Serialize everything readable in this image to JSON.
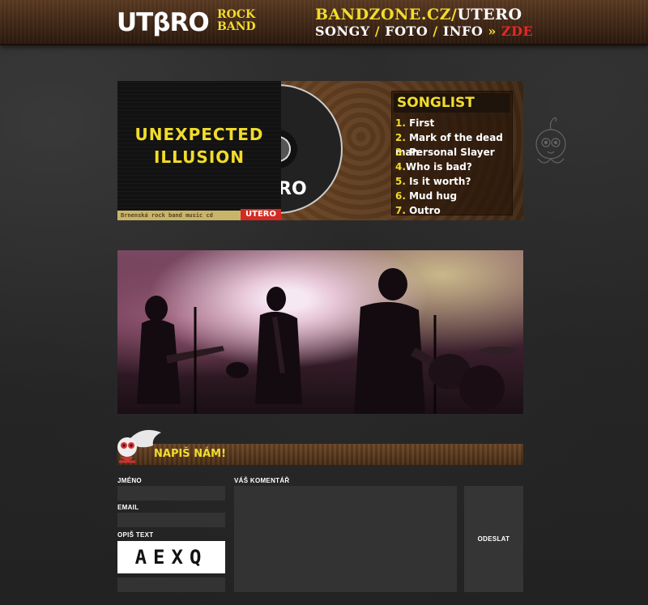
{
  "header": {
    "logo_text": "UTβRO",
    "logo_sub_1": "ROCK",
    "logo_sub_2": "BAND",
    "link_prefix": "BANDZONE.CZ/",
    "link_suffix": "UTERO",
    "nav": [
      {
        "label": "SONGY"
      },
      {
        "label": "FOTO"
      },
      {
        "label": "INFO"
      },
      {
        "label": "ZDE"
      }
    ],
    "sep": "/",
    "arrow": "»"
  },
  "album": {
    "cover_title_1": "UNEXPECTED",
    "cover_title_2": "ILLUSION",
    "cover_strip": "Brnenská rock band music cd",
    "cover_badge": "UTERO",
    "disc_text": "RO",
    "songlist_title": "SONGLIST",
    "songs": [
      {
        "num": "1.",
        "title": "First"
      },
      {
        "num": "2.",
        "title": "Mark of the dead man"
      },
      {
        "num": "3.",
        "title": "Personal Slayer"
      },
      {
        "num": "4.",
        "title": "Who is bad?"
      },
      {
        "num": "5.",
        "title": "Is it worth?"
      },
      {
        "num": "6.",
        "title": "Mud hug"
      },
      {
        "num": "7.",
        "title": "Outro"
      }
    ]
  },
  "contact": {
    "title": "NAPIŠ NÁM!",
    "name_label": "JMÉNO",
    "email_label": "EMAIL",
    "captcha_label": "OPIŠ TEXT",
    "captcha_value": "AEXQ",
    "comment_label": "VÁŠ KOMENTÁŘ",
    "submit_label": "ODESLAT",
    "name_value": "",
    "email_value": "",
    "captcha_input_value": "",
    "comment_value": ""
  }
}
